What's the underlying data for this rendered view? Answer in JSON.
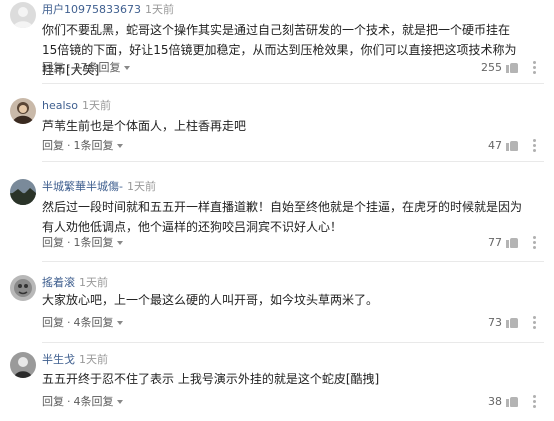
{
  "labels": {
    "reply": "回复",
    "reply_suffix": "回复"
  },
  "comments": [
    {
      "user": "用户10975833673",
      "time": "1天前",
      "text": "你们不要乱黑，蛇哥这个操作其实是通过自己刻苦研发的一个技术，就是把一个硬币挂在15倍镜的下面，好让15倍镜更加稳定，从而达到压枪效果，你们可以直接把这项技术称为挂币[大笑]",
      "reply_count": "27条回复",
      "likes": "255"
    },
    {
      "user": "healso",
      "time": "1天前",
      "text": "芦苇生前也是个体面人，上柱香再走吧",
      "reply_count": "1条回复",
      "likes": "47"
    },
    {
      "user": "半城繁華半城傷-",
      "time": "1天前",
      "text": "然后过一段时间就和五五开一样直播道歉！自始至终他就是个挂逼，在虎牙的时候就是因为有人劝他低调点，他个逼样的还狗咬吕洞宾不识好人心！",
      "reply_count": "1条回复",
      "likes": "77"
    },
    {
      "user": "搖着滚",
      "time": "1天前",
      "text": "大家放心吧，上一个最这么硬的人叫开哥，如今坟头草两米了。",
      "reply_count": "4条回复",
      "likes": "73"
    },
    {
      "user": "半生戈",
      "time": "1天前",
      "text": "五五开终于忍不住了表示 上我号演示外挂的就是这个蛇皮[酷拽]",
      "reply_count": "4条回复",
      "likes": "38"
    }
  ],
  "icons": {
    "like": "thumb-up-icon",
    "more": "more-vertical-icon",
    "dropdown": "chevron-down-icon"
  },
  "colors": {
    "username": "#3f5f8f",
    "time": "#999999",
    "text": "#222222",
    "meta": "#666666"
  }
}
